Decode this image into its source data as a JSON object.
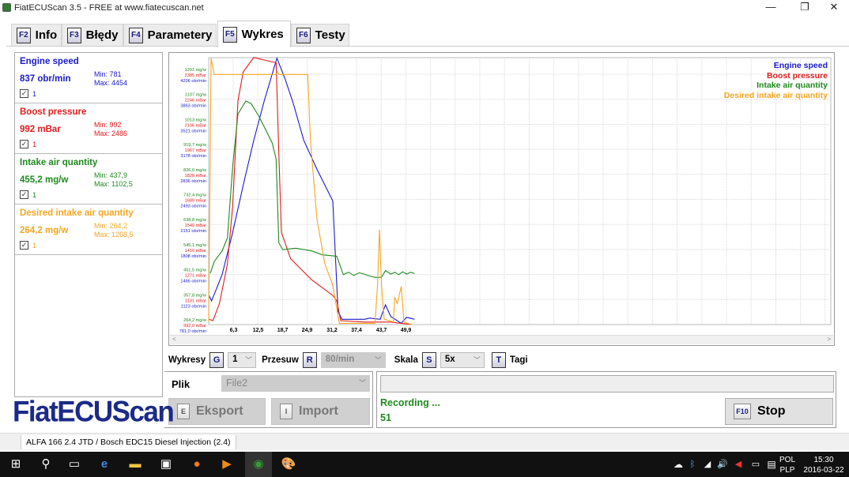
{
  "window": {
    "title": "FiatECUScan 3.5 - FREE at www.fiatecuscan.net",
    "minimize": "—",
    "maximize": "❐",
    "close": "✕"
  },
  "tabs": [
    {
      "key": "F2",
      "label": "Info"
    },
    {
      "key": "F3",
      "label": "Błędy"
    },
    {
      "key": "F4",
      "label": "Parametery"
    },
    {
      "key": "F5",
      "label": "Wykres",
      "active": true
    },
    {
      "key": "F6",
      "label": "Testy"
    }
  ],
  "params": [
    {
      "name": "Engine speed",
      "value": "837 obr/min",
      "min": "Min: 781",
      "max": "Max: 4454",
      "checked": "✓",
      "graph": "1",
      "color": "#1a1acc"
    },
    {
      "name": "Boost pressure",
      "value": "992 mBar",
      "min": "Min: 992",
      "max": "Max: 2486",
      "checked": "✓",
      "graph": "1",
      "color": "#e21b1b"
    },
    {
      "name": "Intake air quantity",
      "value": "455,2 mg/w",
      "min": "Min: 437,9",
      "max": "Max: 1102,5",
      "checked": "✓",
      "graph": "1",
      "color": "#1e8a1e"
    },
    {
      "name": "Desired intake air quantity",
      "value": "264,2 mg/w",
      "min": "Min: 264,2",
      "max": "Max: 1268,5",
      "checked": "✓",
      "graph": "1",
      "color": "#f5a623"
    }
  ],
  "chart_data": {
    "type": "line",
    "xlabel": "",
    "ylabel": "",
    "xlim": [
      0,
      157.4
    ],
    "x_ticks": [
      "6,3",
      "12,5",
      "18,7",
      "24,9",
      "31,2",
      "37,4",
      "43,7",
      "49,9"
    ],
    "x_tick_values": [
      6.3,
      12.5,
      18.7,
      24.9,
      31.2,
      37.4,
      43.7,
      49.9
    ],
    "grid": true,
    "legend_placement": "top-right",
    "y_tick_groups": [
      [
        "264,2 mg/w",
        "992,0 mBar",
        "781,0 obr/min"
      ],
      [
        "357,8 mg/w",
        "1131 mBar",
        "1123 obr/min"
      ],
      [
        "451,5 mg/w",
        "1271 mBar",
        "1466 obr/min"
      ],
      [
        "545,1 mg/w",
        "1410 mBar",
        "1808 obr/min"
      ],
      [
        "638,8 mg/w",
        "1549 mBar",
        "2151 obr/min"
      ],
      [
        "732,4 mg/w",
        "1689 mBar",
        "2493 obr/min"
      ],
      [
        "826,0 mg/w",
        "1828 mBar",
        "2836 obr/min"
      ],
      [
        "919,7 mg/w",
        "1967 mBar",
        "3178 obr/min"
      ],
      [
        "1013 mg/w",
        "2106 mBar",
        "3521 obr/min"
      ],
      [
        "1107 mg/w",
        "2246 mBar",
        "3863 obr/min"
      ],
      [
        "1201 mg/w",
        "2385 mBar",
        "4206 obr/min"
      ]
    ],
    "series": [
      {
        "name": "Engine speed",
        "color": "#1a1acc",
        "ylim": [
          781,
          4206
        ],
        "x": [
          0.07,
          0.73,
          2.07,
          3.4,
          6.07,
          8.73,
          11.4,
          14.07,
          17.27,
          19.4,
          21.4,
          24.07,
          27.4,
          31.4,
          32.73,
          33.73,
          39.4,
          40.73,
          43.4,
          44.73,
          46.07,
          48.73,
          50.07,
          52.07
        ],
        "y": [
          1178,
          1106,
          1286,
          1466,
          2041,
          2689,
          3302,
          3843,
          4425,
          4131,
          3806,
          3302,
          2905,
          2473,
          962,
          853,
          853,
          870,
          853,
          1051,
          890,
          799,
          880,
          853
        ]
      },
      {
        "name": "Boost pressure",
        "color": "#e21b1b",
        "ylim": [
          992,
          2385
        ],
        "x": [
          0.07,
          1.07,
          2.73,
          4.73,
          6.07,
          7.4,
          8.73,
          11.4,
          14.07,
          17.07,
          17.73,
          18.4,
          20.73,
          26.07,
          31.4,
          32.4,
          33.4,
          39.4,
          46.07,
          48.73,
          51.4
        ],
        "y": [
          1021,
          1014,
          1109,
          1329,
          1651,
          2237,
          2398,
          2478,
          2464,
          2449,
          1945,
          1505,
          1358,
          1241,
          1154,
          1124,
          1014,
          1006,
          1006,
          999,
          992
        ]
      },
      {
        "name": "Intake air quantity",
        "color": "#1e8a1e",
        "ylim": [
          264.2,
          1201
        ],
        "x": [
          0.4,
          1.4,
          3.4,
          4.73,
          6.07,
          7.4,
          9.4,
          10.73,
          12.73,
          16.07,
          17.07,
          17.73,
          18.73,
          22.07,
          26.07,
          28.73,
          32.4,
          34.07,
          35.4,
          36.73,
          38.1,
          39.4,
          40.7,
          42.07,
          43.73,
          44.73,
          46.07,
          47.07,
          48.07,
          49.07,
          50.07,
          51.07,
          52.07
        ],
        "y": [
          456,
          500,
          540,
          589,
          855,
          1052,
          1101,
          1091,
          1043,
          944,
          884,
          570,
          545,
          550,
          540,
          525,
          520,
          451,
          460,
          448,
          458,
          453,
          446,
          441,
          441,
          466,
          453,
          460,
          451,
          462,
          453,
          460,
          455
        ]
      },
      {
        "name": "Desired intake air quantity",
        "color": "#f5a623",
        "ylim": [
          264.2,
          1201
        ],
        "x": [
          0,
          0.6,
          1.4,
          17.0,
          17.4,
          17.8,
          25.07,
          25.73,
          27.4,
          29.4,
          31.4,
          32.4,
          33.07,
          42.07,
          42.73,
          43.2,
          43.73,
          44.4,
          46.73,
          47.07,
          47.73,
          48.73,
          49.4,
          51.4
        ],
        "y": [
          274,
          1261,
          1200,
          1200,
          1210,
          1200,
          1200,
          954,
          658,
          491,
          412,
          323,
          269,
          269,
          412,
          619,
          412,
          284,
          274,
          367,
          343,
          407,
          274,
          264
        ]
      }
    ]
  },
  "controls": {
    "wykresy_label": "Wykresy",
    "wykresy_key": "G",
    "wykresy_value": "1",
    "przesuw_label": "Przesuw",
    "przesuw_key": "R",
    "przesuw_value": "80/min",
    "skala_label": "Skala",
    "skala_key": "S",
    "skala_value": "5x",
    "tagi_key": "T",
    "tagi_label": "Tagi"
  },
  "file": {
    "label": "Plik",
    "value": "File2",
    "export_key": "E",
    "export_label": "Eksport",
    "import_key": "I",
    "import_label": "Import"
  },
  "status": {
    "text": "Recording ...",
    "count": "51",
    "stop_key": "F10",
    "stop_label": "Stop"
  },
  "logo": "FiatECUScan",
  "statusbar": {
    "vehicle": "ALFA 166 2.4 JTD / Bosch EDC15 Diesel Injection (2.4)"
  },
  "taskbar": {
    "lang1": "POL",
    "lang2": "PLP",
    "time": "15:30",
    "date": "2016-03-22"
  }
}
